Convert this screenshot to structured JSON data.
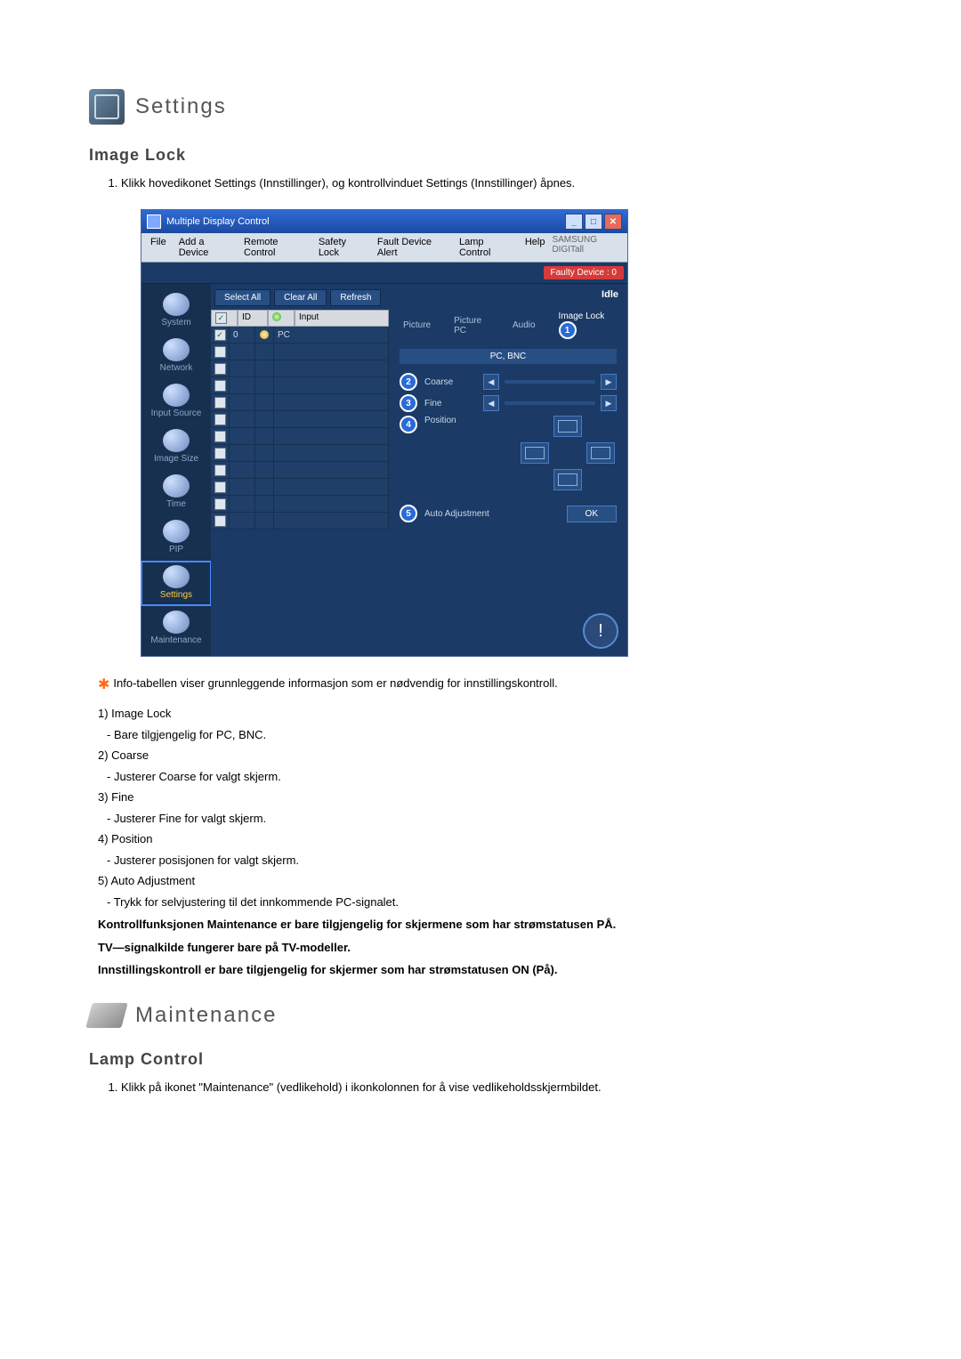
{
  "section1": {
    "title": "Settings",
    "subtitle": "Image Lock",
    "step1": "Klikk hovedikonet Settings (Innstillinger), og kontrollvinduet Settings (Innstillinger) åpnes."
  },
  "window": {
    "title": "Multiple Display Control",
    "brand": "SAMSUNG DIGITall",
    "menu": [
      "File",
      "Add a Device",
      "Remote Control",
      "Safety Lock",
      "Fault Device Alert",
      "Lamp Control",
      "Help"
    ],
    "faulty": "Faulty Device : 0",
    "buttons": {
      "select_all": "Select All",
      "clear_all": "Clear All",
      "refresh": "Refresh"
    },
    "idle": "Idle",
    "table_headers": {
      "id": "ID",
      "input": "Input"
    },
    "row0": {
      "id": "0",
      "input": "PC"
    },
    "tabs": {
      "picture": "Picture",
      "picture_pc": "Picture PC",
      "audio": "Audio",
      "image_lock": "Image Lock"
    },
    "panel_sub": "PC, BNC",
    "controls": {
      "coarse": "Coarse",
      "fine": "Fine",
      "position": "Position",
      "auto": "Auto Adjustment",
      "ok": "OK"
    },
    "sidebar": [
      "System",
      "Network",
      "Input Source",
      "Image Size",
      "Time",
      "PIP",
      "Settings",
      "Maintenance"
    ],
    "markers": {
      "m1": "1",
      "m2": "2",
      "m3": "3",
      "m4": "4",
      "m5": "5"
    }
  },
  "body": {
    "info": "Info-tabellen viser grunnleggende informasjon som er nødvendig for innstillingskontroll.",
    "i1_h": "1)  Image Lock",
    "i1_s": "- Bare tilgjengelig for PC, BNC.",
    "i2_h": "2)  Coarse",
    "i2_s": "- Justerer Coarse for valgt skjerm.",
    "i3_h": "3)  Fine",
    "i3_s": "- Justerer Fine for valgt skjerm.",
    "i4_h": "4)  Position",
    "i4_s": "- Justerer posisjonen for valgt skjerm.",
    "i5_h": "5)  Auto Adjustment",
    "i5_s": "- Trykk for selvjustering til det innkommende PC-signalet.",
    "b1": "Kontrollfunksjonen Maintenance er bare tilgjengelig for skjermene som har strømstatusen PÅ.",
    "b2": "TV—signalkilde fungerer bare på TV-modeller.",
    "b3": "Innstillingskontroll er bare tilgjengelig for skjermer som har strømstatusen ON (På)."
  },
  "section2": {
    "title": "Maintenance",
    "subtitle": "Lamp Control",
    "step1": "Klikk på ikonet \"Maintenance\" (vedlikehold) i ikonkolonnen for å vise vedlikeholdsskjermbildet."
  }
}
